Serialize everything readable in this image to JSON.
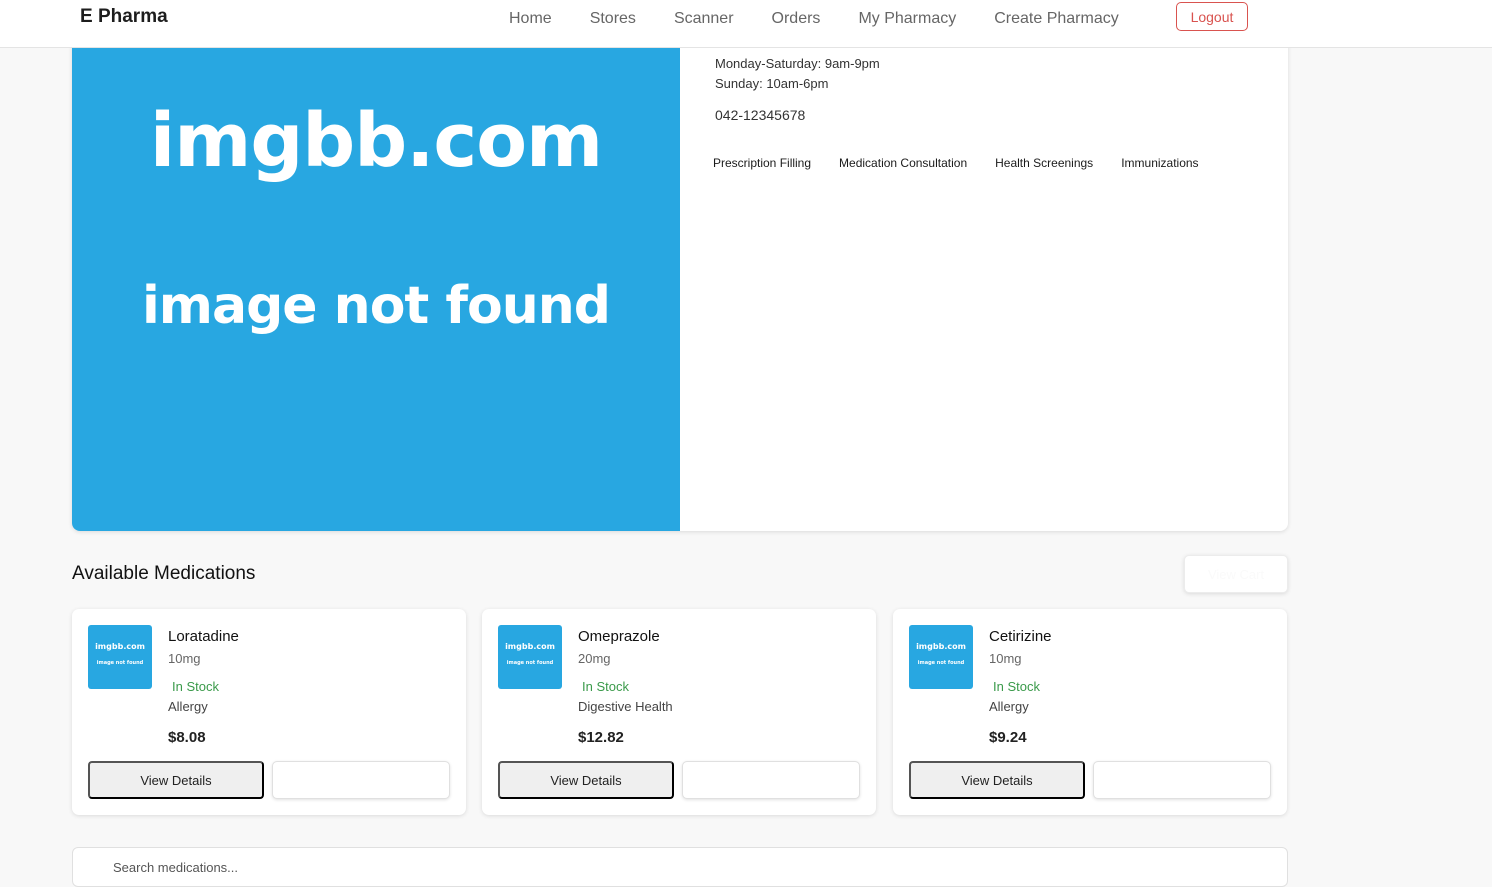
{
  "nav": {
    "brand": "E Pharma",
    "links": [
      "Home",
      "Stores",
      "Scanner",
      "Orders",
      "My Pharmacy",
      "Create Pharmacy"
    ],
    "logout": "Logout"
  },
  "store": {
    "image_placeholder": {
      "line1": "imgbb.com",
      "line2": "image not found"
    },
    "hours": [
      "Monday-Saturday: 9am-9pm",
      "Sunday: 10am-6pm"
    ],
    "phone": "042-12345678",
    "services": [
      "Prescription Filling",
      "Medication Consultation",
      "Health Screenings",
      "Immunizations"
    ]
  },
  "medications": {
    "title": "Available Medications",
    "view_cart": "View Cart",
    "items": [
      {
        "name": "Loratadine",
        "dose": "10mg",
        "stock": "In Stock",
        "category": "Allergy",
        "price": "$8.08",
        "details_label": "View Details",
        "thumb": {
          "line1": "imgbb.com",
          "line2": "image not found"
        }
      },
      {
        "name": "Omeprazole",
        "dose": "20mg",
        "stock": "In Stock",
        "category": "Digestive Health",
        "price": "$12.82",
        "details_label": "View Details",
        "thumb": {
          "line1": "imgbb.com",
          "line2": "image not found"
        }
      },
      {
        "name": "Cetirizine",
        "dose": "10mg",
        "stock": "In Stock",
        "category": "Allergy",
        "price": "$9.24",
        "details_label": "View Details",
        "thumb": {
          "line1": "imgbb.com",
          "line2": "image not found"
        }
      }
    ]
  },
  "search": {
    "placeholder": "Search medications..."
  }
}
